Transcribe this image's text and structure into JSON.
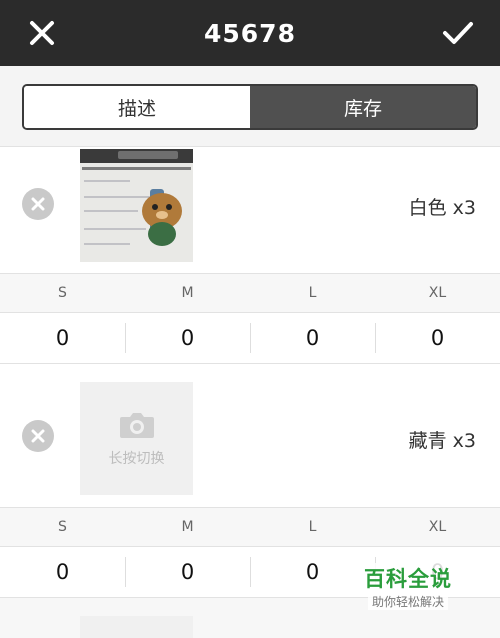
{
  "header": {
    "title": "45678",
    "close_icon": "close-icon",
    "confirm_icon": "check-icon"
  },
  "tabs": {
    "description": "描述",
    "inventory": "库存",
    "active": "inventory"
  },
  "variants": [
    {
      "label": "白色 x3",
      "has_photo": true,
      "sizes": [
        "S",
        "M",
        "L",
        "XL"
      ],
      "quantities": [
        "0",
        "0",
        "0",
        "0"
      ]
    },
    {
      "label": "藏青 x3",
      "has_photo": false,
      "placeholder_text": "长按切换",
      "sizes": [
        "S",
        "M",
        "L",
        "XL"
      ],
      "quantities": [
        "0",
        "0",
        "0",
        "0"
      ]
    }
  ],
  "watermark": {
    "main": "百科全说",
    "sub": "助你轻松解决"
  },
  "colors": {
    "header_bg": "#2b2b2b",
    "active_tab": "#505050",
    "watermark_green": "#2a9d3c"
  }
}
